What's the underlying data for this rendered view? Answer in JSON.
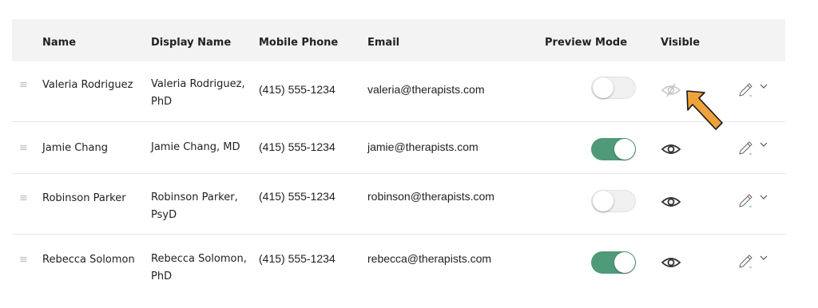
{
  "columns": {
    "name": "Name",
    "display_name": "Display Name",
    "mobile_phone": "Mobile Phone",
    "email": "Email",
    "preview_mode": "Preview Mode",
    "visible": "Visible"
  },
  "rows": [
    {
      "handle": "≡",
      "name": "Valeria Rodriguez",
      "display_name": "Valeria Rodriguez, PhD",
      "phone": "(415) 555-1234",
      "email": "valeria@therapists.com",
      "preview_mode": false,
      "visible": false
    },
    {
      "handle": "≡",
      "name": "Jamie Chang",
      "display_name": "Jamie Chang, MD",
      "phone": "(415) 555-1234",
      "email": "jamie@therapists.com",
      "preview_mode": true,
      "visible": true
    },
    {
      "handle": "≡",
      "name": "Robinson Parker",
      "display_name": "Robinson Parker, PsyD",
      "phone": "(415) 555-1234",
      "email": "robinson@therapists.com",
      "preview_mode": false,
      "visible": true
    },
    {
      "handle": "≡",
      "name": "Rebecca Solomon",
      "display_name": "Rebecca Solomon, PhD",
      "phone": "(415) 555-1234",
      "email": "rebecca@therapists.com",
      "preview_mode": true,
      "visible": true
    }
  ],
  "icons": {
    "drag": "drag-handle-icon",
    "visible_on": "eye-icon",
    "visible_off": "eye-slash-icon",
    "edit": "pencil-icon",
    "menu": "chevron-down-icon",
    "annotation": "arrow-icon"
  },
  "colors": {
    "header_bg": "#f3f3f3",
    "toggle_on": "#4f9a78",
    "toggle_off": "#f0f0f0",
    "annotation_arrow": "#f0a23a"
  }
}
